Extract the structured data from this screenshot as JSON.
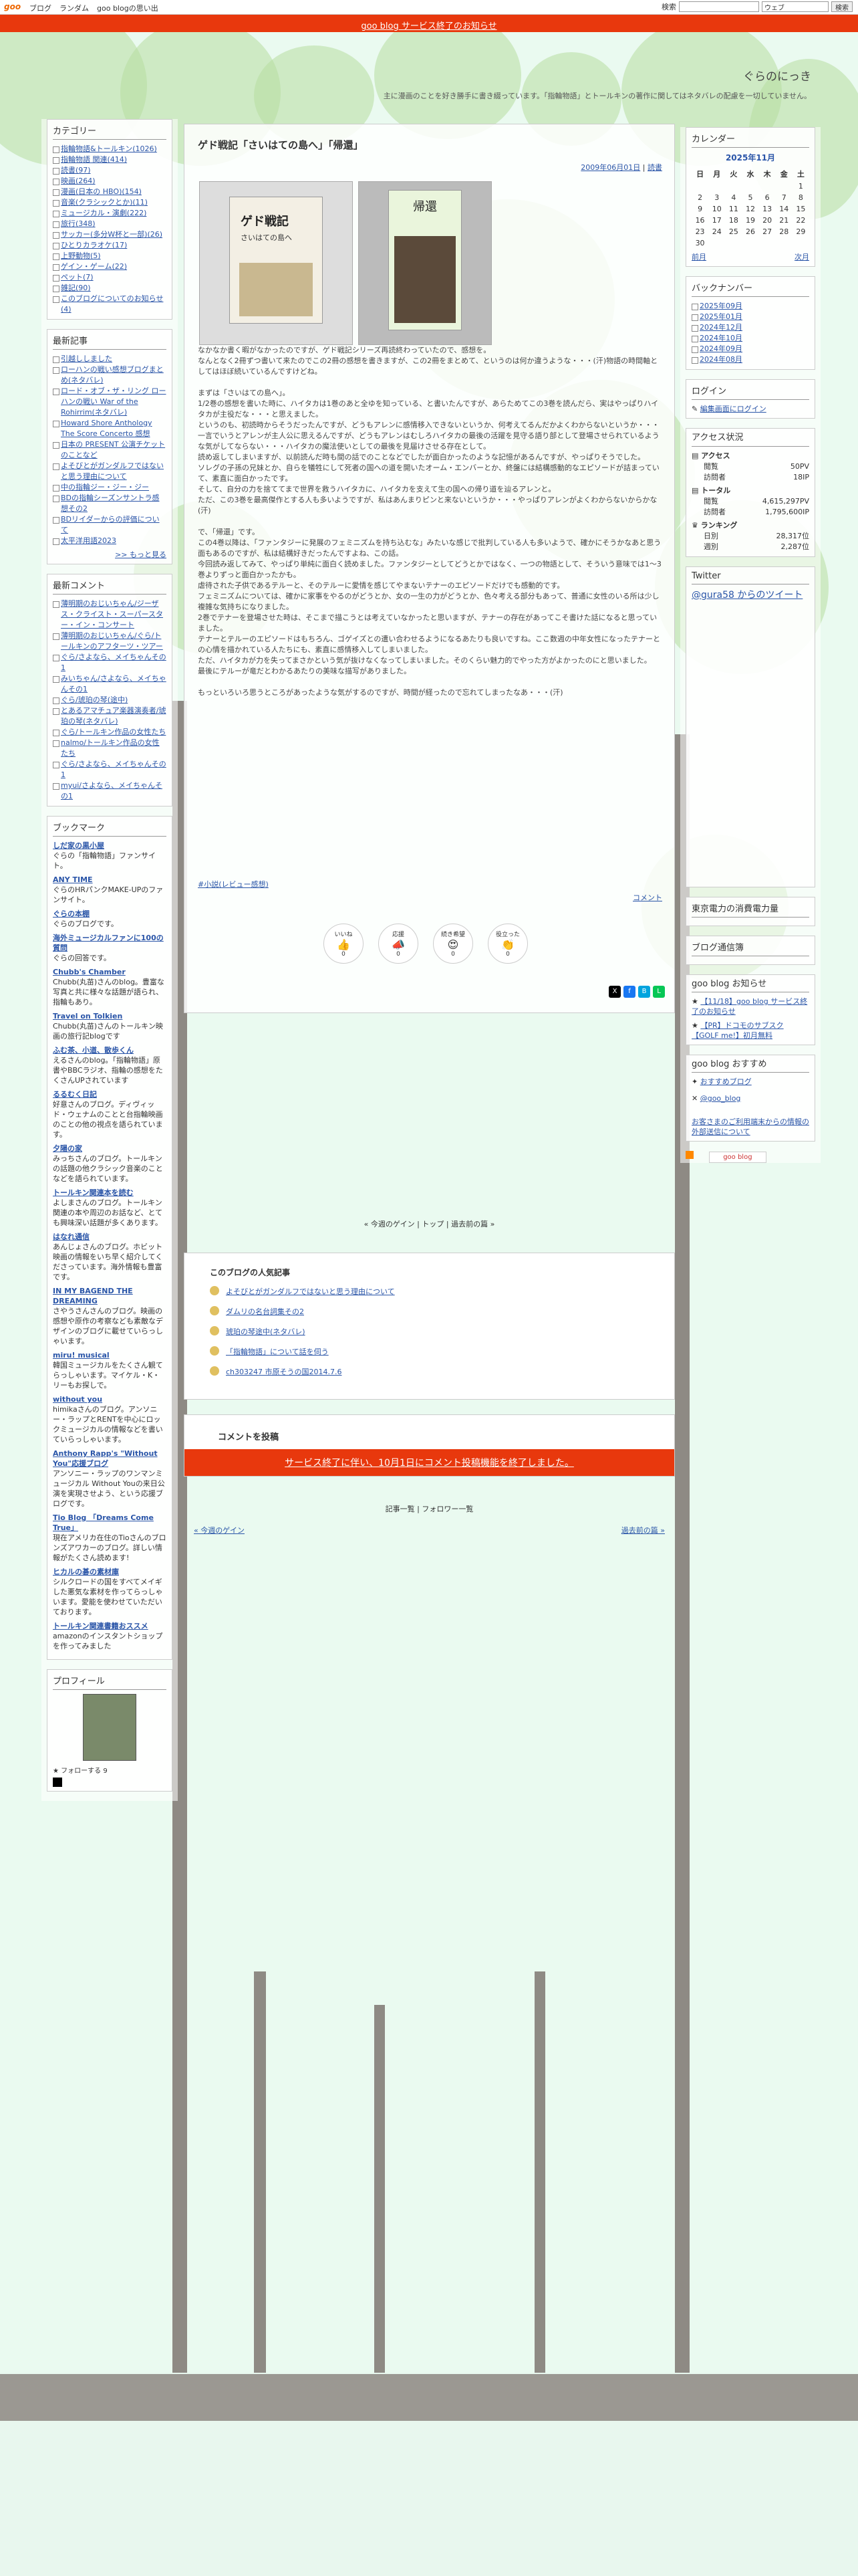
{
  "gnav": {
    "logo": "goo",
    "links": [
      "ブログ",
      "ランダム",
      "goo blogの思い出"
    ],
    "search_label": "検索",
    "search_scope": "ウェブ",
    "search_button": "検索"
  },
  "notice": "goo blog サービス終了のお知らせ",
  "blog": {
    "title": "ぐらのにっき",
    "description": "主に漫画のことを好き勝手に書き綴っています。「指輪物語」とトールキンの著作に関してはネタバレの配慮を一切していません。"
  },
  "left": {
    "category_title": "カテゴリー",
    "categories": [
      "指輪物語&トールキン(1026)",
      "指輪物語 関連(414)",
      "読書(97)",
      "映画(264)",
      "漫画(日本の HBO)(154)",
      "音楽(クラシックとか)(11)",
      "ミュージカル・演劇(222)",
      "旅行(348)",
      "サッカー(多分W杯と一部)(26)",
      "ひとりカラオケ(17)",
      "上野動物(5)",
      "ゲイン・ゲーム(22)",
      "ペット(7)",
      "雑記(90)",
      "このブログについてのお知らせ(4)"
    ],
    "recent_title": "最新記事",
    "recent": [
      "引越ししました",
      "ローハンの戦い感想ブログまとめ(ネタバレ)",
      "ロード・オブ・ザ・リング ローハンの戦い War of the Rohirrim(ネタバレ)",
      "Howard Shore Anthology The Score Concerto 感想",
      "日本の PRESENT 公演チケットのことなど",
      "よそびとがガンダルフではないと思う理由について",
      "中の指輪ジー・ジー・ジー",
      "BDの指輪シーズンサントラ感想その2",
      "BDリイダーからの評価について",
      "太平洋用語2023"
    ],
    "more": ">> もっと見る",
    "comments_title": "最新コメント",
    "comments": [
      "薄明期のおじいちゃん/ジーザス・クライスト・スーパースター・イン・コンサート",
      "薄明期のおじいちゃん/ぐら/トールキンのアフターツ・ツアー",
      "ぐら/さよなら、メイちゃんその1",
      "みいちゃん/さよなら、メイちゃんその1",
      "ぐら/琥珀の琴(途中)",
      "とあるアマチュア楽器演奏者/琥珀の琴(ネタバレ)",
      "ぐら/トールキン作品の女性たち",
      "nalmo/トールキン作品の女性たち",
      "ぐら/さよなら、メイちゃんその1",
      "myui/さよなら、メイちゃんその1"
    ],
    "bookmark_title": "ブックマーク",
    "bookmarks": [
      {
        "name": "しだ家の黒小屋",
        "desc": "ぐらの「指輪物語」ファンサイト。"
      },
      {
        "name": "ANY TIME",
        "desc": "ぐらのHRパンクMAKE-UPのファンサイト。"
      },
      {
        "name": "ぐらの本棚",
        "desc": "ぐらのブログです。"
      },
      {
        "name": "海外ミュージカルファンに100の質問",
        "desc": "ぐらの回答です。"
      },
      {
        "name": "Chubb's Chamber",
        "desc": "Chubb(丸苗)さんのblog。豊富な写真と共に様々な話題が語られ、指輪もあり。"
      },
      {
        "name": "Travel on Tolkien",
        "desc": "Chubb(丸苗)さんのトールキン映画の旅行記blogです"
      },
      {
        "name": "ふむ茶、小道、散歩くん",
        "desc": "えるさんのblog。「指輪物語」原書やBBCラジオ、指輪の感想をたくさんUPされています"
      },
      {
        "name": "るるむく日記",
        "desc": "好意さんのブログ。ディヴィッド・ウェナムのことと台指輪映画のことの他の視点を語られています。"
      },
      {
        "name": "夕陽の家",
        "desc": "みっちさんのブログ。トールキンの話題の他クラシック音楽のことなどを語られています。"
      },
      {
        "name": "トールキン関連本を読む",
        "desc": "よしまさんのブログ。トールキン関連の本や周辺のお話など、とても興味深い話題が多くあります。"
      },
      {
        "name": "はなれ通信",
        "desc": "あんじょさんのブログ。ホビット映画の情報をいち早く紹介してくださっています。海外情報も豊富です。"
      },
      {
        "name": "IN MY BAGEND THE DREAMING",
        "desc": "さやうさんさんのブログ。映画の感想や原作の考察なども素敵なデザインのブログに載せていらっしゃいます。"
      },
      {
        "name": "miru! musical",
        "desc": "韓国ミュージカルをたくさん観てらっしゃいます。マイケル・K・リーもお探しで。"
      },
      {
        "name": "without you",
        "desc": "himikaさんのブログ。アンソニー・ラップとRENTを中心にロックミュージカルの情報などを書いていらっしゃいます。"
      },
      {
        "name": "Anthony Rapp's \"Without You\"応援ブログ",
        "desc": "アンソニー・ラップのワンマンミュージカル Without Youの来日公演を実現させよう、という応援ブログです。"
      },
      {
        "name": "Tio Blog 「Dreams Come True」",
        "desc": "現在アメリカ在住のTioさんのブロンズアワカーのブログ。詳しい情報がたくさん読めます!"
      },
      {
        "name": "ヒカルの碁の素材庫",
        "desc": "シルクロードの国をすべてメイギした悪気な素材を作ってらっしゃいます。愛能を使わせていただいております。"
      },
      {
        "name": "トールキン関連書籍おススメ",
        "desc": "amazonのインスタントショップを作ってみました"
      }
    ],
    "profile_title": "プロフィール",
    "follow_label": "フォローする",
    "follow_count": "9"
  },
  "right": {
    "calendar_title": "カレンダー",
    "calendar_month": "2025年11月",
    "weekdays": [
      "日",
      "月",
      "火",
      "水",
      "木",
      "金",
      "土"
    ],
    "weeks": [
      [
        "",
        "",
        "",
        "",
        "",
        "",
        "1"
      ],
      [
        "2",
        "3",
        "4",
        "5",
        "6",
        "7",
        "8"
      ],
      [
        "9",
        "10",
        "11",
        "12",
        "13",
        "14",
        "15"
      ],
      [
        "16",
        "17",
        "18",
        "19",
        "20",
        "21",
        "22"
      ],
      [
        "23",
        "24",
        "25",
        "26",
        "27",
        "28",
        "29"
      ],
      [
        "30",
        "",
        "",
        "",
        "",
        "",
        ""
      ]
    ],
    "cal_prev": "前月",
    "cal_next": "次月",
    "backnumber_title": "バックナンバー",
    "backnumbers": [
      "2025年09月",
      "2025年01月",
      "2024年12月",
      "2024年10月",
      "2024年09月",
      "2024年08月"
    ],
    "login_title": "ログイン",
    "login_link": "編集画面にログイン",
    "access_title": "アクセス状況",
    "access": {
      "access_label": "アクセス",
      "view_label": "閲覧",
      "view_value": "50PV",
      "visit_label": "訪問者",
      "visit_value": "18IP",
      "total_label": "トータル",
      "tview_value": "4,615,297PV",
      "tvisit_value": "1,795,600IP",
      "rank_label": "ランキング",
      "day_label": "日別",
      "day_value": "28,317位",
      "week_label": "週別",
      "week_value": "2,287位"
    },
    "twitter_title": "Twitter",
    "twitter_link": "@gura58 からのツイート",
    "electric_title": "東京電力の消費電力量",
    "blog_pay_title": "ブログ通信簿",
    "goo_notice_title": "goo blog お知らせ",
    "goo_notices": [
      "【11/18】goo blog サービス終了のお知らせ",
      "【PR】ドコモのサブスク【GOLF me!】初月無料"
    ],
    "goo_recommend_title": "goo blog おすすめ",
    "goo_recommend": [
      "おすすめブログ",
      "@goo_blog"
    ],
    "terms": "お客さまのご利用端末からの情報の外部送信について",
    "badge": "goo blog"
  },
  "article": {
    "title": "ゲド戦記「さいはての島へ」「帰還」",
    "date": "2009年06月01日",
    "category": "読書",
    "book1_cover": "ゲド戦記",
    "book1_sub": "さいはての島へ",
    "book2_cover": "帰還",
    "body": "なかなか書く暇がなかったのですが、ゲド戦記シリーズ再読終わっていたので、感想を。\nなんとなく2冊ずつ書いて来たのでこの2冊の感想を書きますが、この2冊をまとめて、というのは何か違うような・・・(汗)物語の時間軸としてはほぼ続いているんですけどね。\n\nまずは「さいはての島へ」。\n1/2巻の感想を書いた時に、ハイタカは1巻のあと全ゆを知っている、と書いたんですが、あらためてこの3巻を読んだら、実はやっぱりハイタカが主役だな・・・と思えました。\nというのも、初読時からそうだったんですが、どうもアレンに感情移入できないというか、何考えてるんだかよくわからないというか・・・\n一言でいうとアレンが主人公に思えるんですが、どうもアレンはむしろハイタカの最後の活躍を見守る語り部として登場させられているような気がしてならない・・・ハイタカの魔法使いとしての最後を見届けさせる存在として。\n読め返してしまいますが、以前読んだ時も間の話でのことなどでしたが面白かったのような記憶があるんですが、やっぱりそうでした。\nソレグの子孫の兄妹とか、自らを犠牲にして死者の国への道を開いたオーム・エンバーとか、終盤には結構感動的なエピソードが詰まっていて、素直に面白かったです。\nそして、自分の力を捨ててまで世界を救うハイタカに、ハイタカを支えて生の国への帰り道を辿るアレンと。\nただ、この3巻を最高傑作とする人も多いようですが、私はあんまりピンと来ないというか・・・やっぱりアレンがよくわからないからかな(汗)\n\nで、「帰還」です。\nこの4巻以降は、「ファンタジーに発展のフェミニズムを持ち込むな」みたいな感じで批判している人も多いようで、確かにそうかなあと思う面もあるのですが、私は結構好きだったんですよね、この話。\n今回読み返してみて、やっぱり単純に面白く読めました。ファンタジーとしてどうとかではなく、一つの物語として、そういう意味では1～3巻よりずっと面白かったかも。\n虐待された子供であるテルーと、そのテルーに愛情を感じてやまないテナーのエピソードだけでも感動的です。\nフェミニズムについては、確かに家事をやるのがどうとか、女の一生の力がどうとか、色々考える部分もあって、普通に女性のいる所は少し複雑な気持ちになりました。\n2巻でテナーを登場させた時は、そこまで描こうとは考えていなかったと思いますが、テナーの存在があってこそ書けた話になると思っていました。\nテナーとテルーのエピソードはもちろん、ゴゲイズとの遭い合わせるようになるあたりも良いですね。ここ数週の中年女性になったテナーとの心情を描かれている人たちにも、素直に感情移入してしまいました。\nただ、ハイタカが力を失ってまさかという気が抜けなくなってしまいました。そのくらい魅力的でやった方がよかったのにと思いました。\n最後にテルーが竜だとわかるあたりの美味な描写がありました。\n\nもっといろいろ思うところがあったような気がするのですが、時間が経ったので忘れてしまったなあ・・・(汗)",
    "tag": "#小説(レビュー感想)",
    "comment_link": "コメント",
    "reactions": [
      {
        "emoji": "👍",
        "label": "いいね",
        "count": "0"
      },
      {
        "emoji": "📣",
        "label": "応援",
        "count": "0"
      },
      {
        "emoji": "😍",
        "label": "続き希望",
        "count": "0"
      },
      {
        "emoji": "👏",
        "label": "役立った",
        "count": "0"
      }
    ]
  },
  "pager": "« 今週のゲイン | トップ | 過去前の篇 »",
  "popular": {
    "title": "このブログの人気記事",
    "items": [
      "よそびとがガンダルフではないと思う理由について",
      "ダムリの名台詞集その2",
      "琥珀の琴途中(ネタバレ)",
      "「指輪物語」について話を伺う",
      "ch303247 市原そうの国2014.7.6"
    ]
  },
  "post_comment": {
    "title": "コメントを投稿",
    "notice": "サービス終了に伴い、10月1日にコメント投稿機能を終了しました。"
  },
  "bottom_nav": "記事一覧 | フォロワー一覧",
  "prev_link": "« 今週のゲイン",
  "next_link": "過去前の篇 »"
}
